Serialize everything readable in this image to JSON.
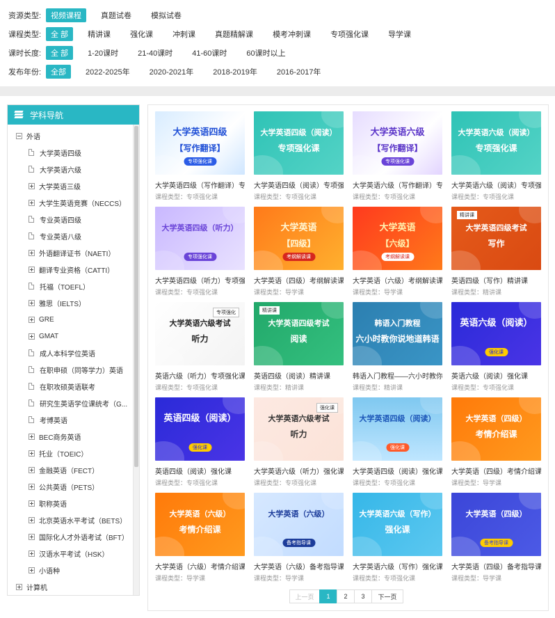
{
  "filters": [
    {
      "label": "资源类型:",
      "options": [
        "视频课程",
        "真题试卷",
        "模拟试卷"
      ],
      "active": 0
    },
    {
      "label": "课程类型:",
      "options": [
        "全 部",
        "精讲课",
        "强化课",
        "冲刺课",
        "真题精解课",
        "模考冲刺课",
        "专项强化课",
        "导学课"
      ],
      "active": 0
    },
    {
      "label": "课时长度:",
      "options": [
        "全 部",
        "1-20课时",
        "21-40课时",
        "41-60课时",
        "60课时以上"
      ],
      "active": 0
    },
    {
      "label": "发布年份:",
      "options": [
        "全部",
        "2022-2025年",
        "2020-2021年",
        "2018-2019年",
        "2016-2017年"
      ],
      "active": 0
    }
  ],
  "sidebar": {
    "title": "学科导航",
    "root": "外语",
    "items": [
      {
        "label": "大学英语四级",
        "type": "doc"
      },
      {
        "label": "大学英语六级",
        "type": "doc"
      },
      {
        "label": "大学英语三级",
        "type": "plus"
      },
      {
        "label": "大学生英语竞赛（NECCS）",
        "type": "plus"
      },
      {
        "label": "专业英语四级",
        "type": "doc"
      },
      {
        "label": "专业英语八级",
        "type": "doc"
      },
      {
        "label": "外语翻译证书（NAETI）",
        "type": "plus"
      },
      {
        "label": "翻译专业资格（CATTI）",
        "type": "plus"
      },
      {
        "label": "托福（TOEFL）",
        "type": "doc"
      },
      {
        "label": "雅思（IELTS）",
        "type": "plus"
      },
      {
        "label": "GRE",
        "type": "plus"
      },
      {
        "label": "GMAT",
        "type": "plus"
      },
      {
        "label": "成人本科学位英语",
        "type": "doc"
      },
      {
        "label": "在职申硕（同等学力）英语",
        "type": "doc"
      },
      {
        "label": "在职攻硕英语联考",
        "type": "doc"
      },
      {
        "label": "研究生英语学位课统考（G...",
        "type": "doc"
      },
      {
        "label": "考博英语",
        "type": "doc"
      },
      {
        "label": "BEC商务英语",
        "type": "plus"
      },
      {
        "label": "托业（TOEIC）",
        "type": "plus"
      },
      {
        "label": "金融英语（FECT）",
        "type": "plus"
      },
      {
        "label": "公共英语（PETS）",
        "type": "plus"
      },
      {
        "label": "职称英语",
        "type": "plus"
      },
      {
        "label": "北京英语水平考试（BETS）",
        "type": "plus"
      },
      {
        "label": "国际化人才外语考试（BFT）",
        "type": "plus"
      },
      {
        "label": "汉语水平考试（HSK）",
        "type": "plus"
      },
      {
        "label": "小语种",
        "type": "plus"
      }
    ],
    "bottom": "计算机"
  },
  "cards": [
    {
      "title": "大学英语四级（写作翻译）专",
      "type": "课程类型：专项强化课",
      "img": {
        "bg": "linear-gradient(135deg,#d8ecff,#ffffff 60%,#cfe6ff)",
        "t1": "大学英语四级",
        "t2": "【写作翻译】",
        "c": "#1f4fd6",
        "pill": "专项强化课",
        "pillbg": "#2b5ce6",
        "pillc": "#fff"
      }
    },
    {
      "title": "大学英语四级（阅读）专项强",
      "type": "课程类型：专项强化课",
      "img": {
        "bg": "linear-gradient(135deg,#2fc3b6,#54d3c6)",
        "t1": "大学英语四级（阅读）",
        "t2": "专项强化课",
        "c": "#fff",
        "pill": "",
        "pillbg": "",
        "pillc": "",
        "small": true
      }
    },
    {
      "title": "大学英语六级（写作翻译）专",
      "type": "课程类型：专项强化课",
      "img": {
        "bg": "linear-gradient(135deg,#e6dcff,#ffffff 60%,#e2d4ff)",
        "t1": "大学英语六级",
        "t2": "【写作翻译】",
        "c": "#5a34c8",
        "pill": "专项强化课",
        "pillbg": "#6a44d8",
        "pillc": "#fff"
      }
    },
    {
      "title": "大学英语六级（阅读）专项强",
      "type": "课程类型：专项强化课",
      "img": {
        "bg": "linear-gradient(135deg,#2fc3b6,#54d3c6)",
        "t1": "大学英语六级（阅读）",
        "t2": "专项强化课",
        "c": "#fff",
        "pill": "",
        "pillbg": "",
        "pillc": "",
        "small": true
      }
    },
    {
      "title": "大学英语四级（听力）专项强",
      "type": "课程类型：专项强化课",
      "img": {
        "bg": "linear-gradient(135deg,#c9b8ff,#e9e2ff)",
        "t1": "大学英语四级（听力）",
        "t2": "",
        "c": "#6a44d8",
        "pill": "专项强化课",
        "pillbg": "#6a44d8",
        "pillc": "#fff",
        "small": true
      }
    },
    {
      "title": "大学英语（四级）考纲解读课",
      "type": "课程类型：导学课",
      "img": {
        "bg": "linear-gradient(135deg,#ff7a1a,#ffb02e)",
        "t1": "大学英语",
        "t2": "【四级】",
        "c": "#fff8d6",
        "pill": "考纲解读课",
        "pillbg": "#d6261e",
        "pillc": "#fff"
      }
    },
    {
      "title": "大学英语（六级）考纲解读课",
      "type": "课程类型：导学课",
      "img": {
        "bg": "linear-gradient(135deg,#ff3a1e,#ff7a1a)",
        "t1": "大学英语",
        "t2": "【六级】",
        "c": "#fff3b0",
        "pill": "考纲解读课",
        "pillbg": "#fff",
        "pillc": "#d6261e"
      }
    },
    {
      "title": "英语四级（写作）精讲课",
      "type": "课程类型：精讲课",
      "img": {
        "bg": "linear-gradient(135deg,#e55a1a,#d94a12)",
        "t1": "大学英语四级考试",
        "t2": "写作",
        "c": "#fff",
        "pill": "",
        "pillbg": "",
        "pillc": "",
        "tagL": "精讲课",
        "small": true
      }
    },
    {
      "title": "英语六级（听力）专项强化课",
      "type": "课程类型：专项强化课",
      "img": {
        "bg": "linear-gradient(135deg,#ffffff,#f3f3f3)",
        "t1": "大学英语六级考试",
        "t2": "听力",
        "c": "#222",
        "pill": "",
        "pillbg": "",
        "pillc": "",
        "tag": "专项强化",
        "small": true
      }
    },
    {
      "title": "英语四级（阅读）精讲课",
      "type": "课程类型：精讲课",
      "img": {
        "bg": "linear-gradient(135deg,#22a86a,#34c07f)",
        "t1": "大学英语四级考试",
        "t2": "阅读",
        "c": "#fff",
        "pill": "",
        "pillbg": "",
        "pillc": "",
        "tagL": "精讲课",
        "small": true
      }
    },
    {
      "title": "韩语入门教程——六小时教你",
      "type": "课程类型：精讲课",
      "img": {
        "bg": "linear-gradient(135deg,#2c7fb0,#3a95c6)",
        "t1": "韩语入门教程",
        "t2": "六小时教你说地道韩语",
        "c": "#fff",
        "pill": "",
        "pillbg": "",
        "pillc": "",
        "small": true
      }
    },
    {
      "title": "英语六级（阅读）强化课",
      "type": "课程类型：专项强化课",
      "img": {
        "bg": "linear-gradient(135deg,#2a2ad8,#4a34e6)",
        "t1": "英语六级（阅读）",
        "t2": "",
        "c": "#fff",
        "pill": "强化课",
        "pillbg": "#ffcc00",
        "pillc": "#2a2ad8"
      }
    },
    {
      "title": "英语四级（阅读）强化课",
      "type": "课程类型：专项强化课",
      "img": {
        "bg": "linear-gradient(135deg,#2a2ad8,#4a34e6)",
        "t1": "英语四级（阅读）",
        "t2": "",
        "c": "#fff",
        "pill": "强化课",
        "pillbg": "#ffcc00",
        "pillc": "#2a2ad8"
      }
    },
    {
      "title": "大学英语六级（听力）强化课",
      "type": "课程类型：专项强化课",
      "img": {
        "bg": "linear-gradient(135deg,#fde9e2,#fbe3d8)",
        "t1": "大学英语六级考试",
        "t2": "听力",
        "c": "#333",
        "pill": "",
        "pillbg": "",
        "pillc": "",
        "tag": "强化课",
        "small": true
      }
    },
    {
      "title": "大学英语四级（阅读）强化课",
      "type": "课程类型：专项强化课",
      "img": {
        "bg": "linear-gradient(180deg,#7fc8f0,#bfe6ff)",
        "t1": "大学英语四级（阅读）",
        "t2": "",
        "c": "#1c56b8",
        "pill": "强化课",
        "pillbg": "#ff5a2a",
        "pillc": "#fff",
        "small": true
      }
    },
    {
      "title": "大学英语（四级）考情介绍课",
      "type": "课程类型：导学课",
      "img": {
        "bg": "linear-gradient(135deg,#ff7a0a,#ff9a1e)",
        "t1": "大学英语（四级）",
        "t2": "考情介绍课",
        "c": "#fff",
        "pill": "",
        "pillbg": "",
        "pillc": "",
        "small": true
      }
    },
    {
      "title": "大学英语（六级）考情介绍课",
      "type": "课程类型：导学课",
      "img": {
        "bg": "linear-gradient(135deg,#ff7a0a,#ff9a1e)",
        "t1": "大学英语（六级）",
        "t2": "考情介绍课",
        "c": "#fff",
        "pill": "",
        "pillbg": "",
        "pillc": "",
        "small": true
      }
    },
    {
      "title": "大学英语（六级）备考指导课",
      "type": "课程类型：导学课",
      "img": {
        "bg": "linear-gradient(135deg,#d6e8ff,#c2dcff)",
        "t1": "大学英语（六级）",
        "t2": "",
        "c": "#1c3c9a",
        "pill": "备考指导课",
        "pillbg": "#1c3c9a",
        "pillc": "#fff",
        "small": true
      }
    },
    {
      "title": "大学英语六级（写作）强化课",
      "type": "课程类型：专项强化课",
      "img": {
        "bg": "linear-gradient(135deg,#36b7e8,#5cc8f0)",
        "t1": "大学英语六级（写作）",
        "t2": "强化课",
        "c": "#fff",
        "pill": "",
        "pillbg": "",
        "pillc": "",
        "small": true
      }
    },
    {
      "title": "大学英语（四级）备考指导课",
      "type": "课程类型：导学课",
      "img": {
        "bg": "linear-gradient(135deg,#3b46d8,#4c5ae6)",
        "t1": "大学英语（四级）",
        "t2": "",
        "c": "#fff",
        "pill": "备考指导课",
        "pillbg": "#ffcc00",
        "pillc": "#3b46d8",
        "small": true
      }
    }
  ],
  "pagination": {
    "prev": "上一页",
    "pages": [
      "1",
      "2",
      "3"
    ],
    "active": "1",
    "next": "下一页"
  }
}
